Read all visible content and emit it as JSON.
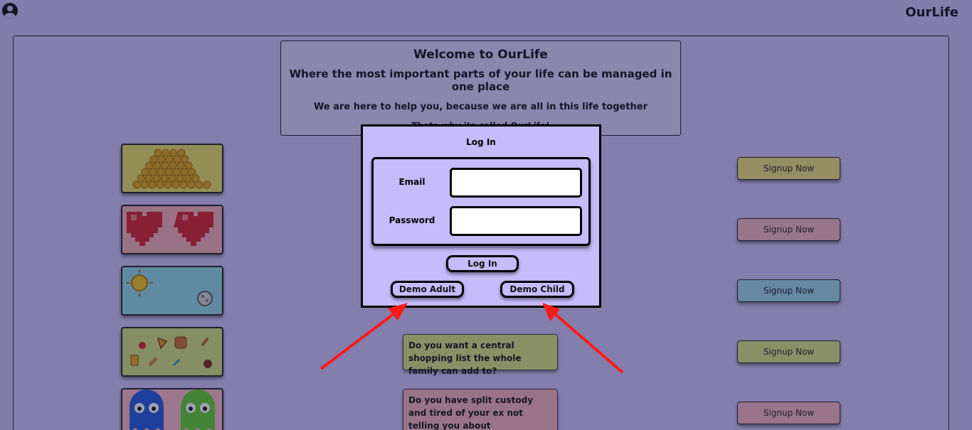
{
  "header": {
    "brand": "OurLife"
  },
  "welcome": {
    "title": "Welcome to OurLife",
    "subtitle": "Where the most important parts of your life can be managed in one place",
    "tagline": "We are here to help you, because we are all in this life together",
    "note": "Thats why its called OurLife!"
  },
  "tiles": [
    {
      "icon": "coins-icon",
      "color": "#e6e163"
    },
    {
      "icon": "hearts-icon",
      "color": "#f2b1b3"
    },
    {
      "icon": "sun-moon-icon",
      "color": "#8fd9e4"
    },
    {
      "icon": "food-icon",
      "color": "#cfe07a"
    },
    {
      "icon": "ghosts-icon",
      "color": "#f6b9c1"
    }
  ],
  "signup_buttons": [
    {
      "label": "Signup Now",
      "color": "#e8e178"
    },
    {
      "label": "Signup Now",
      "color": "#f0b8bf"
    },
    {
      "label": "Signup Now",
      "color": "#9ad6e6"
    },
    {
      "label": "Signup Now",
      "color": "#d6e47e"
    },
    {
      "label": "Signup Now",
      "color": "#f2b4bd"
    }
  ],
  "question_cards": [
    {
      "text": "Do you want a central shopping list the whole family can add to?",
      "color": "#d7e47c"
    },
    {
      "text": "Do you have split custody and tired of your ex not telling you about appointments?",
      "color": "#f1b4bb"
    }
  ],
  "login_modal": {
    "title": "Log In",
    "email_label": "Email",
    "email_value": "",
    "password_label": "Password",
    "password_value": "",
    "login_button": "Log In",
    "demo_adult_button": "Demo Adult",
    "demo_child_button": "Demo Child"
  },
  "annotation_color": "#ff1a1a"
}
